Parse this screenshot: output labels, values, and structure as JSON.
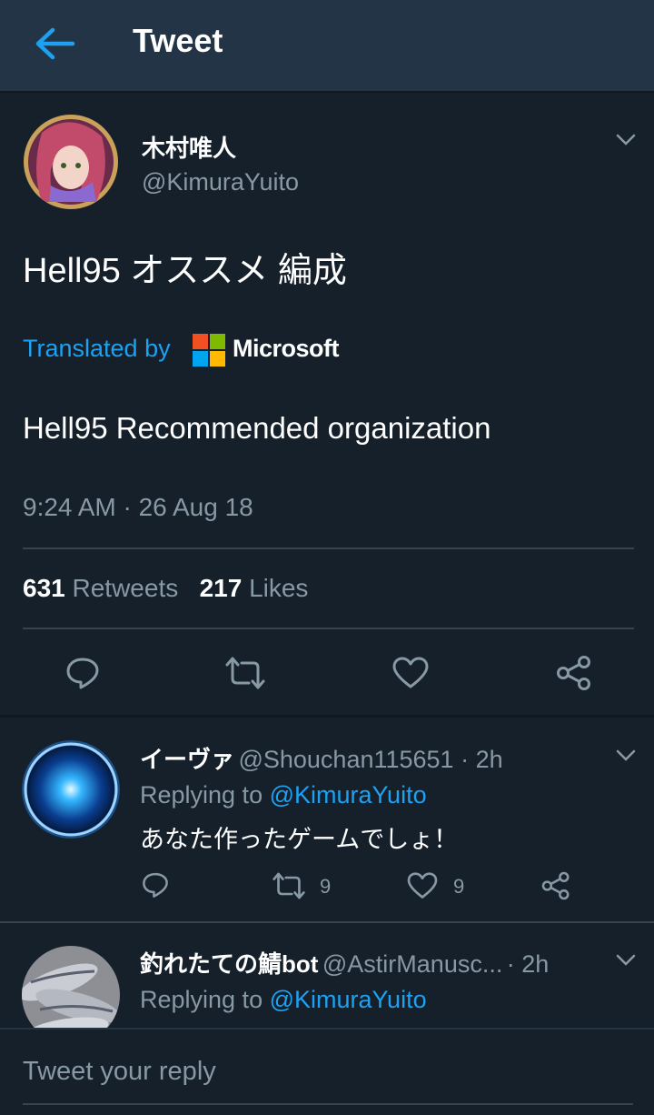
{
  "header": {
    "title": "Tweet"
  },
  "tweet": {
    "author_name": "木村唯人",
    "author_handle": "@KimuraYuito",
    "text": "Hell95 オススメ 編成",
    "translated_by_label": "Translated by",
    "translator_name": "Microsoft",
    "translation": "Hell95 Recommended organization",
    "timestamp": "9:24 AM · 26 Aug 18",
    "retweets_count": "631",
    "retweets_label": "Retweets",
    "likes_count": "217",
    "likes_label": "Likes"
  },
  "replies": [
    {
      "name": "イーヴァ",
      "handle_time": "@Shouchan115651 · 2h",
      "replying_prefix": "Replying to",
      "replying_mention": "@KimuraYuito",
      "text": "あなた作ったゲームでしょ！",
      "retweets": "9",
      "likes": "9"
    },
    {
      "name": "釣れたての鯖bot",
      "handle": "@AstirManusc...",
      "time": "· 2h",
      "replying_prefix": "Replying to",
      "replying_mention": "@KimuraYuito"
    }
  ],
  "composer": {
    "placeholder": "Tweet your reply"
  },
  "colors": {
    "background": "#15202b",
    "header": "#243447",
    "accent": "#1da1f2",
    "secondary_text": "#8899a6",
    "divider": "#38444d"
  },
  "icons": [
    "back-arrow-icon",
    "chevron-down-icon",
    "reply-icon",
    "retweet-icon",
    "like-icon",
    "share-icon",
    "microsoft-logo-icon"
  ]
}
